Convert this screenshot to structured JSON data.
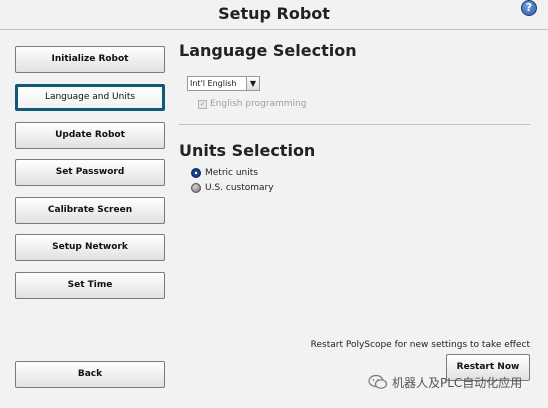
{
  "header": {
    "title": "Setup Robot",
    "help_icon": "?"
  },
  "nav": {
    "items": [
      {
        "label": "Initialize Robot"
      },
      {
        "label": "Language and Units"
      },
      {
        "label": "Update Robot"
      },
      {
        "label": "Set Password"
      },
      {
        "label": "Calibrate Screen"
      },
      {
        "label": "Setup Network"
      },
      {
        "label": "Set Time"
      }
    ],
    "selected": "Language and Units",
    "back_label": "Back"
  },
  "language": {
    "title": "Language Selection",
    "selected_language": "Int'l English",
    "dropdown_arrow": "▼",
    "english_programming_label": "English programming",
    "english_programming_checked": true,
    "check_mark": "✓"
  },
  "units": {
    "title": "Units Selection",
    "options": [
      {
        "label": "Metric units",
        "selected": true
      },
      {
        "label": "U.S. customary",
        "selected": false
      }
    ]
  },
  "restart": {
    "note": "Restart PolyScope for new settings to take effect",
    "button_label": "Restart Now"
  },
  "watermark": {
    "text": "机器人及PLC自动化应用"
  },
  "colors": {
    "selected_border": "#0f5a78",
    "radio_on": "#1c4a9b"
  }
}
